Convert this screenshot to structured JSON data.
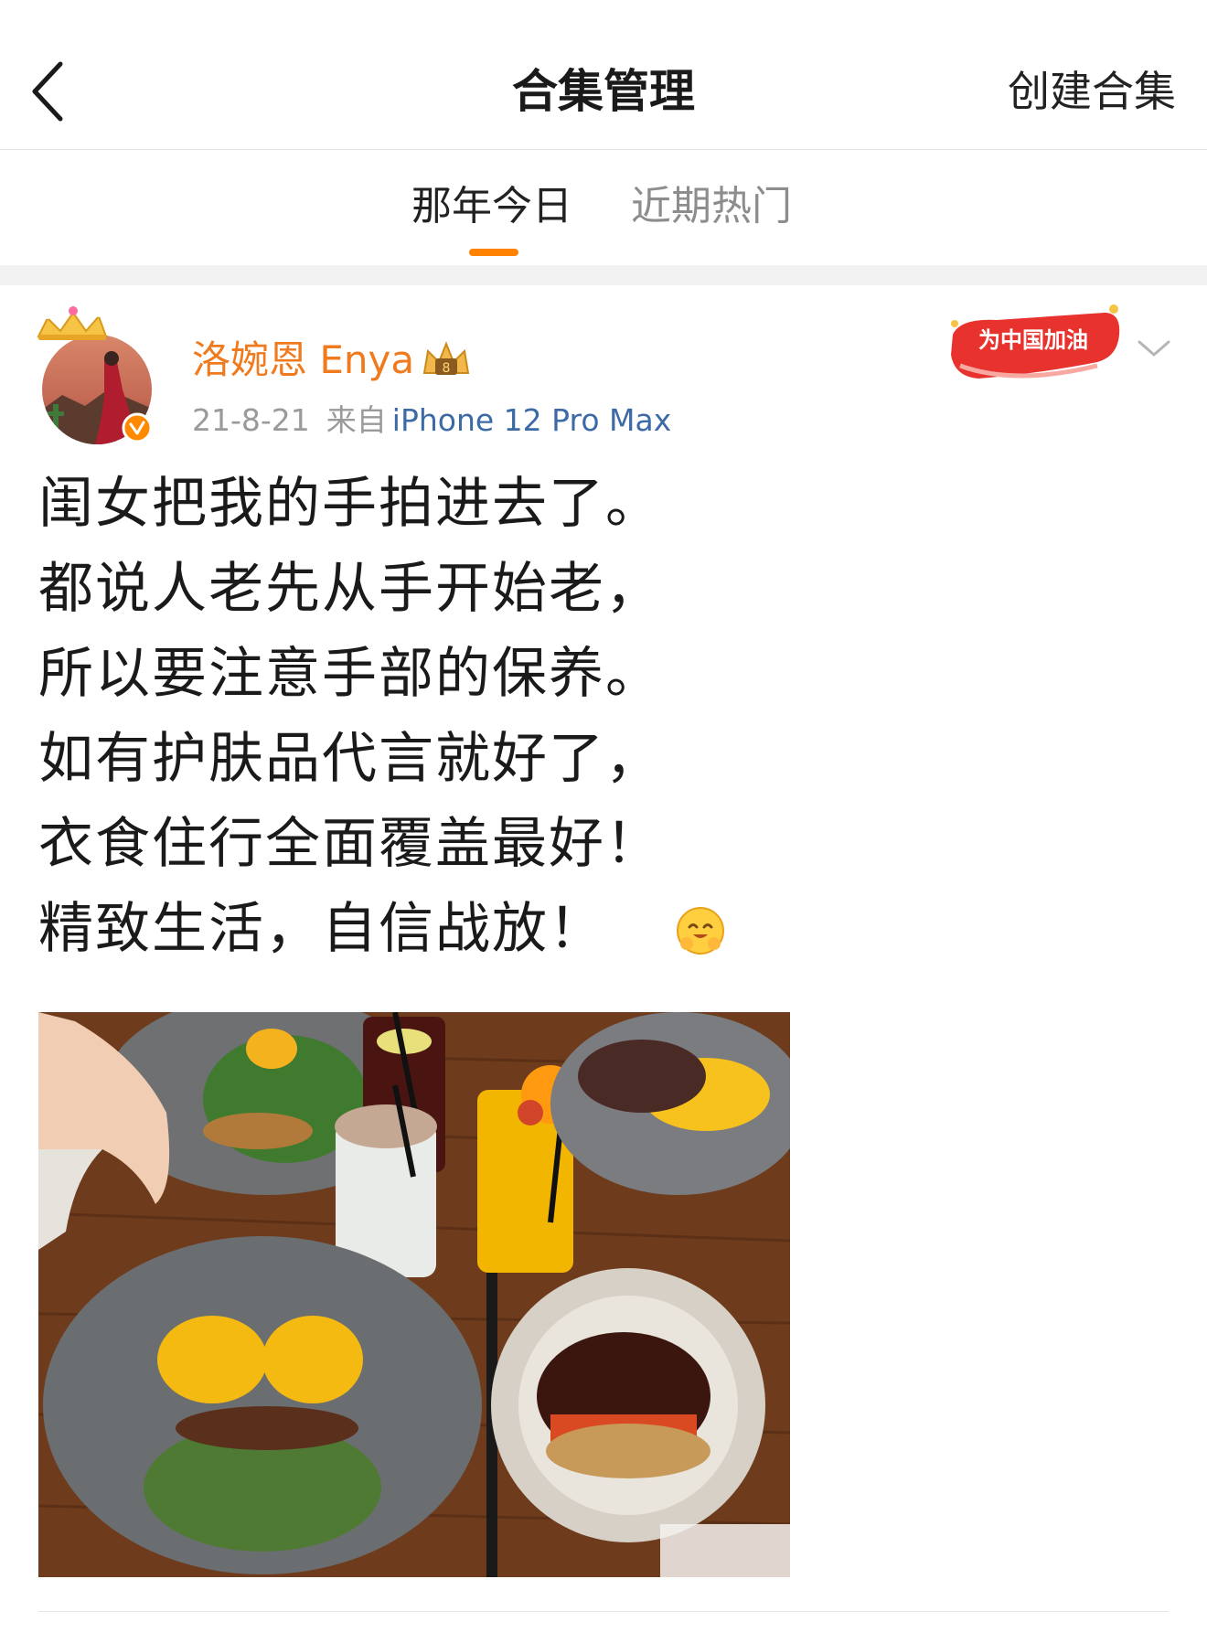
{
  "header": {
    "title": "合集管理",
    "create_label": "创建合集"
  },
  "tabs": [
    {
      "label": "那年今日",
      "active": true
    },
    {
      "label": "近期热门",
      "active": false
    }
  ],
  "post": {
    "user_name": "洛婉恩 Enya",
    "date": "21-8-21",
    "from_label": "来自",
    "device": "iPhone 12 Pro Max",
    "badge_text": "为中国加油",
    "text": "闺女把我的手拍进去了。\n都说人老先从手开始老，\n所以要注意手部的保养。\n如有护肤品代言就好了，\n衣食住行全面覆盖最好！\n精致生活，自信战放！",
    "emoji": "hug-emoji"
  },
  "colors": {
    "accent": "#ff8200",
    "username": "#f07a1e",
    "device_link": "#3c6aa7",
    "badge_red": "#e8322d"
  }
}
